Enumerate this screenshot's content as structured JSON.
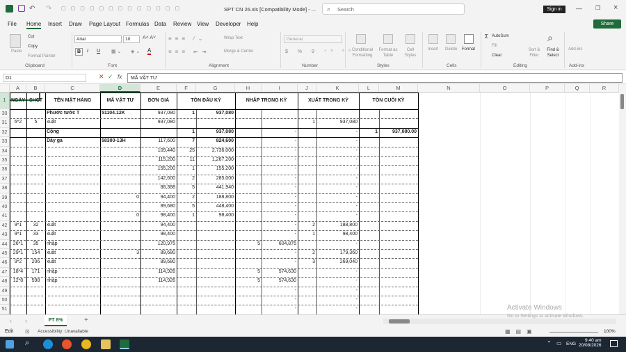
{
  "titlebar": {
    "title": "SPT CN 26.xls [Compatibility Mode] - ...",
    "search_placeholder": "Search",
    "signin": "Sign in"
  },
  "menu": {
    "tabs": [
      "File",
      "Home",
      "Insert",
      "Draw",
      "Page Layout",
      "Formulas",
      "Data",
      "Review",
      "View",
      "Developer",
      "Help"
    ],
    "share": "Share"
  },
  "ribbon": {
    "clipboard": {
      "paste": "Paste",
      "cut": "Cut",
      "copy": "Copy",
      "format_painter": "Format Painter",
      "group": "Clipboard"
    },
    "font": {
      "name": "Arial",
      "size": "10",
      "group": "Font"
    },
    "alignment": {
      "wrap": "Wrap Text",
      "merge": "Merge & Center",
      "group": "Alignment"
    },
    "number": {
      "format": "General",
      "group": "Number"
    },
    "styles": {
      "cond": "Conditional Formatting",
      "table": "Format as Table",
      "cell": "Cell Styles",
      "group": "Styles"
    },
    "cells": {
      "insert": "Insert",
      "delete": "Delete",
      "format": "Format",
      "group": "Cells"
    },
    "editing": {
      "autosum": "AutoSum",
      "fill": "Fill",
      "clear": "Clear",
      "sort": "Sort & Filter",
      "find": "Find & Select",
      "group": "Editing"
    },
    "addins": {
      "label": "Add-ins",
      "group": "Add-ins"
    }
  },
  "formula_bar": {
    "namebox": "D1",
    "fx": "fx",
    "content": "MÃ VẬT TƯ"
  },
  "columns": [
    "A",
    "B",
    "C",
    "D",
    "E",
    "F",
    "G",
    "H",
    "I",
    "J",
    "K",
    "L",
    "M",
    "N",
    "O",
    "P",
    "Q",
    "R"
  ],
  "headers": {
    "A": "NGÀY",
    "B": "SHCT",
    "C": "TÊN MẶT HÀNG",
    "D": "MÃ VẬT TƯ",
    "E": "ĐƠN GIÁ",
    "FG": "TỒN ĐẦU KỲ",
    "HI": "NHẬP TRONG KỲ",
    "JK": "XUẤT TRONG KỲ",
    "LM": "TỒN CUỐI KỲ"
  },
  "rows": [
    {
      "n": "1"
    },
    {
      "n": "30",
      "C": "Phước tước T",
      "D": "51104.12K",
      "E": "937,080",
      "F": "1",
      "G": "937,080"
    },
    {
      "n": "31",
      "A": "6*2",
      "B": "5",
      "C": "xuất",
      "E": "937,080",
      "J": "1",
      "K": "937,080"
    },
    {
      "n": "32",
      "C": "Cộng",
      "F": "1",
      "G": "937,080",
      "I": "-",
      "K": "-",
      "L": "1",
      "M": "937,080.00"
    },
    {
      "n": "33",
      "C": "Dây ga",
      "D": "58300-13H",
      "E": "117,600",
      "F": "7",
      "G": "824,600",
      "I": "-",
      "K": "-"
    },
    {
      "n": "34",
      "E": "109,440",
      "F": "25",
      "G": "2,736,000",
      "I": "-",
      "K": "-"
    },
    {
      "n": "35",
      "E": "115,200",
      "F": "11",
      "G": "1,267,200",
      "I": "-",
      "K": "-"
    },
    {
      "n": "36",
      "E": "155,200",
      "F": "1",
      "G": "155,200",
      "I": "-",
      "K": "-"
    },
    {
      "n": "37",
      "E": "142,600",
      "F": "2",
      "G": "285,000",
      "I": "-",
      "K": "-"
    },
    {
      "n": "38",
      "E": "88,388",
      "F": "5",
      "G": "441,940",
      "I": "-",
      "K": "-"
    },
    {
      "n": "39",
      "D": "0",
      "E": "94,400",
      "F": "2",
      "G": "188,800",
      "I": "-",
      "K": "-"
    },
    {
      "n": "40",
      "E": "89,680",
      "F": "5",
      "G": "448,400",
      "I": "-",
      "K": "-"
    },
    {
      "n": "41",
      "D": "0",
      "E": "98,400",
      "F": "1",
      "G": "98,400",
      "I": "-",
      "K": "-"
    },
    {
      "n": "42",
      "A": "9*1",
      "B": "32",
      "C": "xuất",
      "E": "94,400",
      "I": "-",
      "J": "2",
      "K": "188,800"
    },
    {
      "n": "43",
      "A": "9*1",
      "B": "33",
      "C": "xuất",
      "E": "98,400",
      "I": "-",
      "J": "1",
      "K": "98,400"
    },
    {
      "n": "44",
      "A": "26*1",
      "B": "35",
      "C": "nhập",
      "E": "120,975",
      "H": "5",
      "I": "604,875",
      "K": "-"
    },
    {
      "n": "45",
      "A": "29*1",
      "B": "154",
      "C": "xuất",
      "D": "3",
      "E": "89,680",
      "I": "-",
      "J": "2",
      "K": "179,360"
    },
    {
      "n": "46",
      "A": "9*2",
      "B": "206",
      "C": "xuất",
      "E": "89,680",
      "I": "-",
      "J": "3",
      "K": "269,040"
    },
    {
      "n": "47",
      "A": "18*4",
      "B": "171",
      "C": "nhập",
      "E": "114,926",
      "H": "5",
      "I": "574,630",
      "K": "-"
    },
    {
      "n": "48",
      "A": "12*8",
      "B": "598",
      "C": "nhập",
      "E": "114,926",
      "H": "5",
      "I": "574,630",
      "K": "-"
    },
    {
      "n": "49",
      "I": "-",
      "K": "-"
    },
    {
      "n": "50",
      "I": "-",
      "K": "-"
    },
    {
      "n": "51",
      "I": "-",
      "K": "-"
    }
  ],
  "sheet": {
    "tab": "PT 8%",
    "add": "+"
  },
  "status": {
    "mode": "Edit",
    "accessibility": "Accessibility: Unavailable",
    "zoom": "100%"
  },
  "watermark": {
    "line1": "Activate Windows",
    "line2": "Go to Settings to activate Windows."
  },
  "taskbar": {
    "lang": "ENG",
    "time": "9:40 am",
    "date": "20/08/2026"
  },
  "colors": {
    "accent": "#1e6b3c",
    "taskbar": "#1c2733"
  }
}
